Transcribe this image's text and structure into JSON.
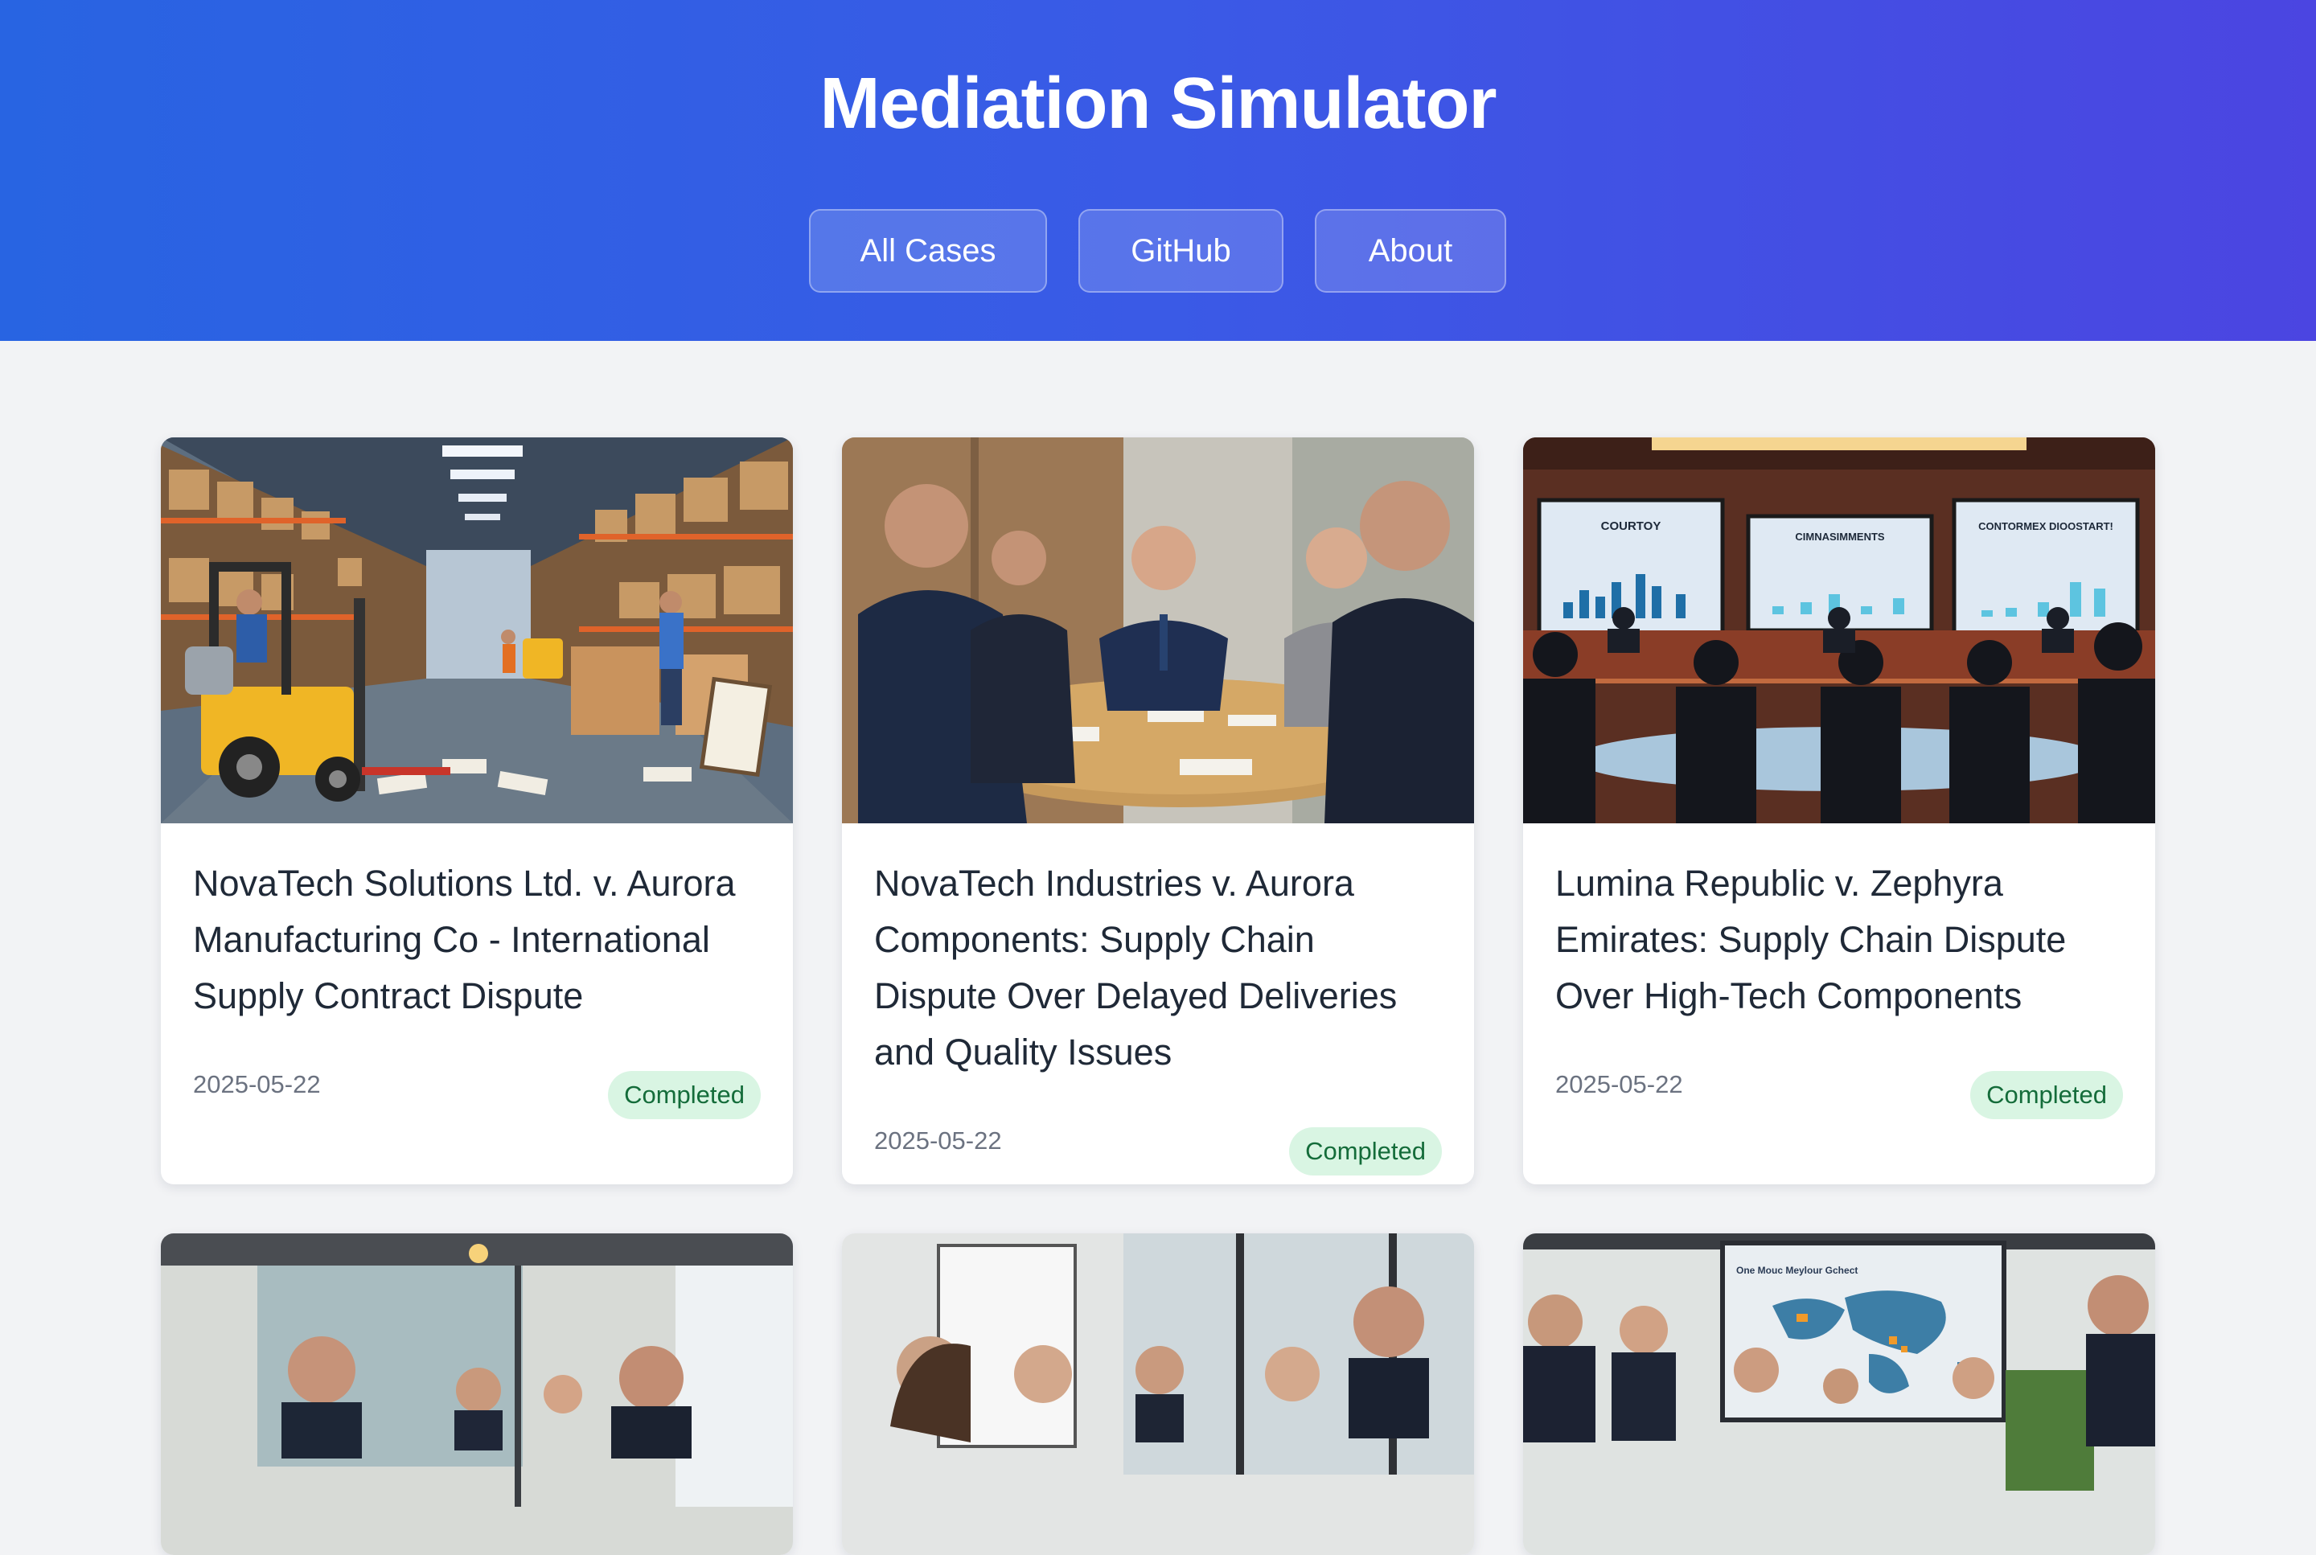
{
  "header": {
    "title": "Mediation Simulator",
    "nav": [
      {
        "label": "All Cases"
      },
      {
        "label": "GitHub"
      },
      {
        "label": "About"
      }
    ]
  },
  "cases": [
    {
      "title": "NovaTech Solutions Ltd. v. Aurora Manufacturing Co - International Supply Contract Dispute",
      "date": "2025-05-22",
      "status": "Completed",
      "image": "warehouse-photo"
    },
    {
      "title": "NovaTech Industries v. Aurora Components: Supply Chain Dispute Over Delayed Deliveries and Quality Issues",
      "date": "2025-05-22",
      "status": "Completed",
      "image": "meeting-table-photo"
    },
    {
      "title": "Lumina Republic v. Zephyra Emirates: Supply Chain Dispute Over High-Tech Components",
      "date": "2025-05-22",
      "status": "Completed",
      "image": "conference-screens-photo"
    },
    {
      "image": "office-meeting-photo"
    },
    {
      "image": "boardroom-photo"
    },
    {
      "image": "world-map-presentation-photo"
    }
  ],
  "thumb_texts": {
    "screen1": "COURTOY",
    "screen2": "CIMNASIMMENTS",
    "screen3": "CONTORMEX DIOOSTART!",
    "map_title": "One Mouc Meylour Gchect"
  },
  "colors": {
    "header_start": "#2864e2",
    "header_end": "#4b45e1",
    "badge_bg": "#d9f5e3",
    "badge_text": "#146c3a",
    "page_bg": "#f2f3f5"
  }
}
